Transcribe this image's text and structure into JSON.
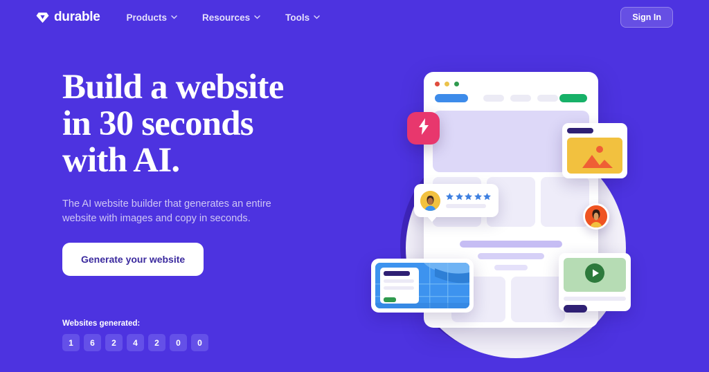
{
  "header": {
    "logo_text": "durable",
    "logo_icon": "gem-diamond-icon",
    "nav": [
      {
        "label": "Products",
        "icon": "chevron-down-icon"
      },
      {
        "label": "Resources",
        "icon": "chevron-down-icon"
      },
      {
        "label": "Tools",
        "icon": "chevron-down-icon"
      }
    ],
    "sign_in_label": "Sign In"
  },
  "hero": {
    "headline": "Build a website\nin 30 seconds\nwith AI.",
    "subhead": "The AI website builder that generates an entire website with images and copy in seconds.",
    "cta_label": "Generate your website",
    "counter_label": "Websites generated:",
    "counter_digits": [
      "1",
      "6",
      "2",
      "4",
      "2",
      "0",
      "0"
    ]
  },
  "illustration": {
    "browser": {
      "traffic_lights": [
        "red-dot",
        "yellow-dot",
        "green-dot"
      ],
      "nav_pill_left": "blue-pill",
      "nav_pills_center": [
        "gray-pill",
        "gray-pill",
        "gray-pill"
      ],
      "nav_pill_right": "green-pill"
    },
    "floating_cards": [
      {
        "name": "lightning-bolt-badge",
        "icon": "lightning-bolt-icon"
      },
      {
        "name": "image-card",
        "icon": "photo-mountain-icon"
      },
      {
        "name": "review-card",
        "icon": "star-icon",
        "stars": 5
      },
      {
        "name": "avatar-badge",
        "icon": "person-avatar-icon"
      },
      {
        "name": "video-card",
        "icon": "play-icon"
      },
      {
        "name": "map-card",
        "icon": "map-icon"
      }
    ]
  },
  "colors": {
    "background": "#4d33e0",
    "accent_white": "#ffffff",
    "cta_text": "#3b2a9e",
    "digit_box": "#6450e8",
    "bolt_badge": "#e8376d",
    "image_card": "#f2c13f",
    "video_card": "#b6dcb4",
    "map_card": "#3d93ef",
    "avatar_badge": "#ef5422",
    "star": "#3d7fe0"
  }
}
